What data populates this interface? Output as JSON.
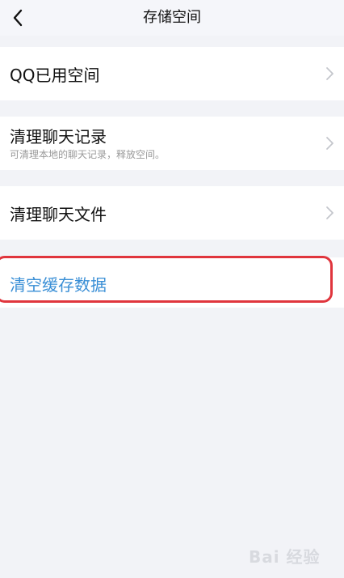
{
  "nav": {
    "title": "存储空间",
    "back_icon": "chevron-left-icon"
  },
  "rows": {
    "used_space": {
      "label": "QQ已用空间"
    },
    "clear_records": {
      "label": "清理聊天记录",
      "subtitle": "可清理本地的聊天记录，释放空间。"
    },
    "clear_files": {
      "label": "清理聊天文件"
    },
    "clear_cache": {
      "label": "清空缓存数据"
    }
  },
  "colors": {
    "page_bg": "#f2f3f7",
    "row_bg": "#ffffff",
    "accent_blue": "#3a8fd6",
    "highlight_red": "#e0353d"
  },
  "watermark": {
    "text": "Bai 经验"
  }
}
